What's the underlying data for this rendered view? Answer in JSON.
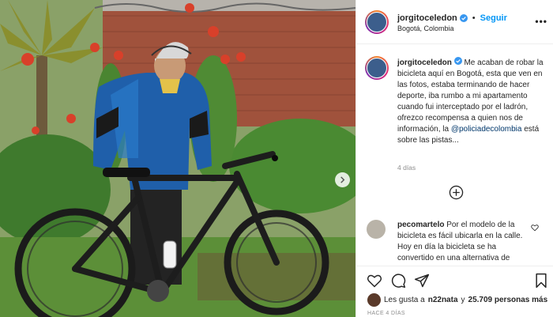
{
  "post": {
    "username": "jorgitoceledon",
    "follow_label": "Seguir",
    "dot": "•",
    "location": "Bogotá, Colombia",
    "more_label": "•••",
    "caption_before": "Me acaban de robar la bicicleta aquí en Bogotá, esta que ven en las fotos, estaba terminando de hacer deporte, iba rumbo a mi apartamento cuando fui interceptado por el ladrón, ofrezco recompensa a quien nos de información, la ",
    "caption_mention": "@policiadecolombia",
    "caption_after": " está sobre las pistas...",
    "time_ago": "4 días",
    "date": "HACE 4 DÍAS"
  },
  "comment": {
    "username": "pecomartelo",
    "text": "Por el modelo de la bicicleta es fácil ubicarla en la calle. Hoy en día la bicicleta se ha convertido en una alternativa de"
  },
  "likes": {
    "prefix": "Les gusta a",
    "user": "n22nata",
    "connector": "y",
    "count": "25.709 personas más"
  },
  "icons": {
    "verified": "verified-badge-icon",
    "like": "heart-icon",
    "comment": "comment-bubble-icon",
    "share": "paper-plane-icon",
    "save": "bookmark-icon",
    "load_more": "plus-circle-icon",
    "next": "chevron-right-icon"
  },
  "colors": {
    "accent": "#0095f6",
    "verified": "#3897f0",
    "muted": "#8e8e8e",
    "text": "#262626"
  }
}
